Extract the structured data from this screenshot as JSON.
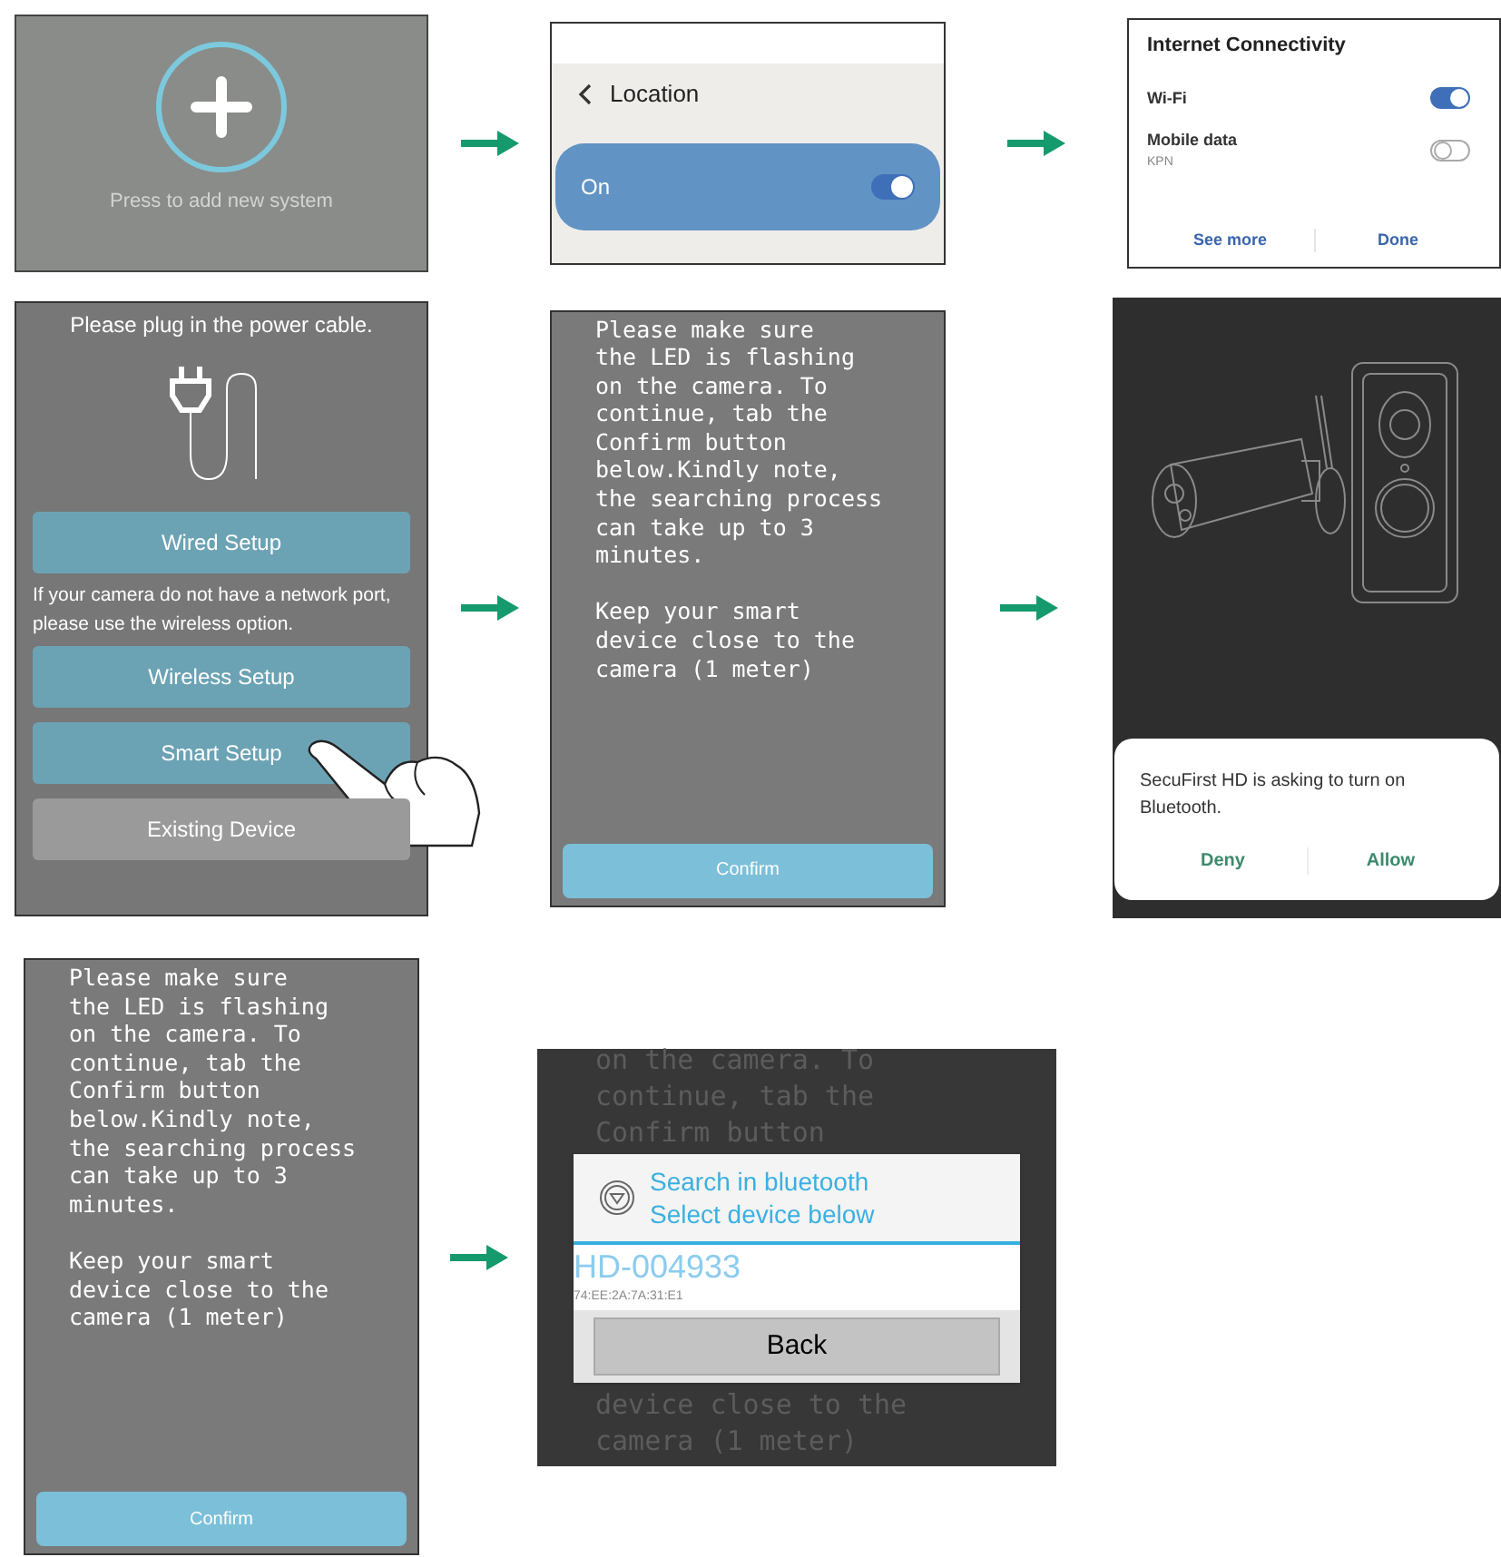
{
  "rows": [
    {
      "screens": [
        {
          "kind": "add_system",
          "caption": "Press to add new system"
        },
        {
          "kind": "location",
          "title": "Location",
          "option": {
            "label": "On",
            "on": true
          }
        },
        {
          "kind": "connectivity",
          "title": "Internet Connectivity",
          "items": [
            {
              "label": "Wi-Fi",
              "on": true
            },
            {
              "label": "Mobile data",
              "sublabel": "KPN",
              "on": false
            }
          ],
          "actions": [
            "See more",
            "Done"
          ]
        }
      ]
    },
    {
      "screens": [
        {
          "kind": "plug",
          "title": "Please plug in the power cable.",
          "items": [
            {
              "kind": "button",
              "label": "Wired Setup"
            },
            {
              "kind": "note",
              "text": "If your camera do not have a network port, please use the wireless option."
            },
            {
              "kind": "button",
              "label": "Wireless Setup"
            },
            {
              "kind": "button",
              "label": "Smart Setup",
              "tapped": true
            },
            {
              "kind": "muted_button",
              "label": "Existing Device"
            }
          ]
        },
        {
          "kind": "instructions",
          "text": "Please make sure\nthe LED is flashing\non the camera. To\ncontinue, tab the\nConfirm button\nbelow.Kindly note,\nthe searching process\ncan take up to 3\nminutes.\n\nKeep your smart\ndevice close to the\ncamera (1 meter)",
          "button": "Confirm"
        },
        {
          "kind": "bluetooth_request",
          "message": "SecuFirst HD is asking to turn on Bluetooth.",
          "actions": [
            "Deny",
            "Allow"
          ]
        }
      ]
    },
    {
      "screens": [
        {
          "kind": "instructions",
          "text": "Please make sure\nthe LED is flashing\non the camera. To\ncontinue, tab the\nConfirm button\nbelow.Kindly note,\nthe searching process\ncan take up to 3\nminutes.\n\nKeep your smart\ndevice close to the\ncamera (1 meter)",
          "button": "Confirm"
        },
        {
          "kind": "device_select",
          "text_above": "on the camera. To\ncontinue, tab the\nConfirm button",
          "title_lines": [
            "Search in bluetooth",
            "Select device below"
          ],
          "device": {
            "name": "HD-004933",
            "address": "74:EE:2A:7A:31:E1"
          },
          "button": "Back",
          "text_below": "device close to the\ncamera (1 meter)"
        }
      ]
    }
  ]
}
